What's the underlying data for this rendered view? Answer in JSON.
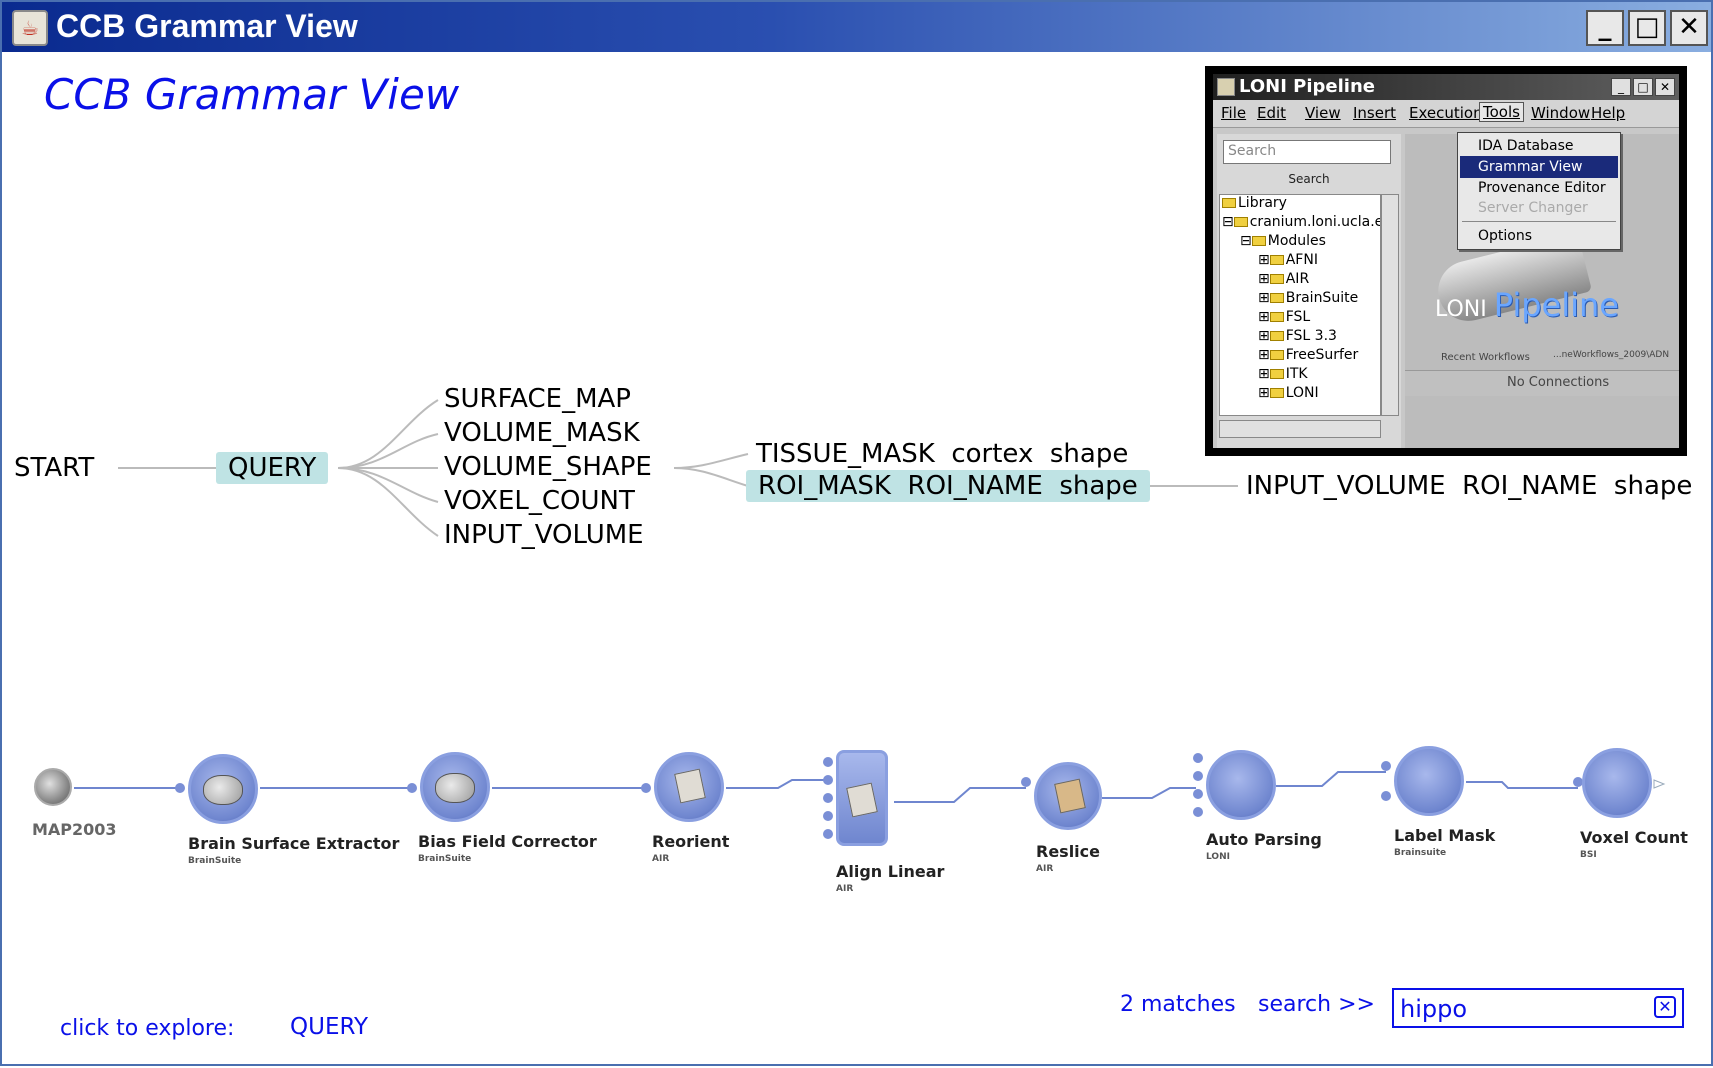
{
  "window": {
    "title": "CCB Grammar View",
    "icon": "java-icon",
    "controls": [
      "minimize-icon",
      "maximize-icon",
      "close-icon"
    ]
  },
  "header": {
    "title": "CCB Grammar View"
  },
  "grammar_tree": {
    "root": "START",
    "query": "QUERY",
    "query_children": [
      "SURFACE_MAP",
      "VOLUME_MASK",
      "VOLUME_SHAPE",
      "VOXEL_COUNT",
      "INPUT_VOLUME"
    ],
    "shape_children": [
      "TISSUE_MASK  cortex  shape",
      "ROI_MASK  ROI_NAME  shape"
    ],
    "roi_child": "INPUT_VOLUME  ROI_NAME  shape",
    "highlight_color": "#bfe3e4"
  },
  "pipeline_window": {
    "title": "LONI Pipeline",
    "menu": [
      "File",
      "Edit",
      "View",
      "Insert",
      "Execution",
      "Tools",
      "Window",
      "Help"
    ],
    "search_placeholder": "Search",
    "search_label": "Search",
    "tree": [
      "Library",
      "cranium.loni.ucla.e",
      "Modules",
      "AFNI",
      "AIR",
      "BrainSuite",
      "FSL",
      "FSL 3.3",
      "FreeSurfer",
      "ITK",
      "LONI"
    ],
    "tools_menu": [
      "IDA Database",
      "Grammar View",
      "Provenance Editor",
      "Server Changer",
      "Options"
    ],
    "brand_prefix": "LONI",
    "brand_name": "Pipeline",
    "recent_label": "Recent Workflows",
    "recent_item": "...neWorkflows_2009\\ADN",
    "status": "No Connections"
  },
  "workflow": {
    "modules": [
      {
        "name": "MAP2003",
        "sub": ""
      },
      {
        "name": "Brain Surface Extractor",
        "sub": "BrainSuite"
      },
      {
        "name": "Bias Field Corrector",
        "sub": "BrainSuite"
      },
      {
        "name": "Reorient",
        "sub": "AIR"
      },
      {
        "name": "Align Linear",
        "sub": "AIR"
      },
      {
        "name": "Reslice",
        "sub": "AIR"
      },
      {
        "name": "Auto Parsing",
        "sub": "LONI"
      },
      {
        "name": "Label Mask",
        "sub": "Brainsuite"
      },
      {
        "name": "Voxel Count",
        "sub": "BSI"
      }
    ],
    "module_color": "#7a8fd6",
    "link_color": "#6f86cf"
  },
  "footer": {
    "explore_label": "click to explore:",
    "explore_target": "QUERY",
    "matches": "2 matches",
    "search_link": "search >>",
    "search_value": "hippo",
    "clear_icon": "clear-icon",
    "text_color": "#0a10e8"
  }
}
